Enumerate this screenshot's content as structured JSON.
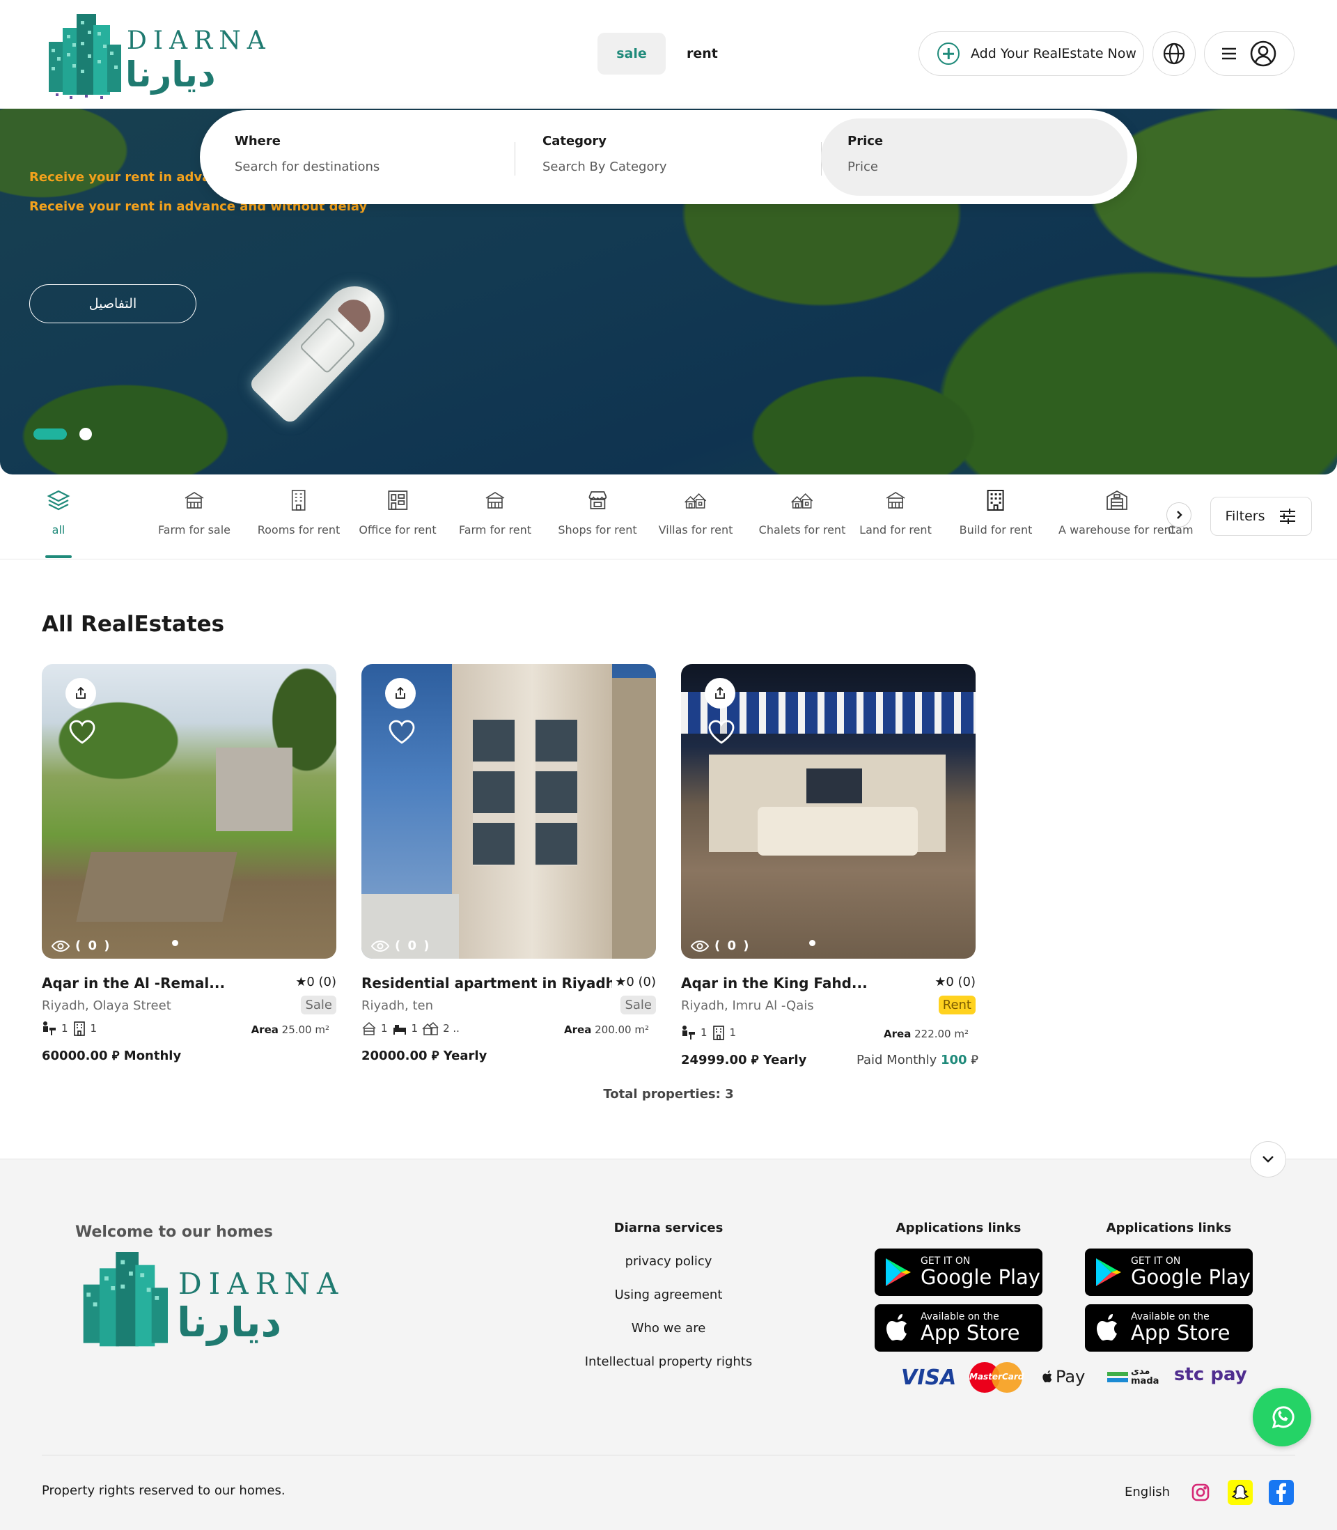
{
  "header": {
    "brand_en": "DIARNA",
    "brand_ar": "ديارنا",
    "mode_tabs": [
      {
        "label": "sale",
        "active": true
      },
      {
        "label": "rent",
        "active": false
      }
    ],
    "add_button": "Add Your RealEstate Now",
    "accent_color": "#1f8a7a"
  },
  "hero": {
    "line1": "Receive your rent in advance and without delay",
    "line2": "Receive your rent in advance and without delay",
    "details_button": "التفاصيل",
    "slides": 2,
    "active_slide": 1
  },
  "search": {
    "where_label": "Where",
    "where_placeholder": "Search for destinations",
    "category_label": "Category",
    "category_placeholder": "Search By Category",
    "price_label": "Price",
    "price_placeholder": "Price"
  },
  "categories": [
    {
      "label": "all",
      "icon": "layers-icon",
      "active": true
    },
    {
      "label": "Farm for sale",
      "icon": "farm-icon"
    },
    {
      "label": "Rooms for rent",
      "icon": "building-icon"
    },
    {
      "label": "Office for rent",
      "icon": "office-icon"
    },
    {
      "label": "Farm for rent",
      "icon": "farm-icon"
    },
    {
      "label": "Shops for rent",
      "icon": "shop-icon"
    },
    {
      "label": "Villas for rent",
      "icon": "villa-icon"
    },
    {
      "label": "Chalets for rent",
      "icon": "chalet-icon"
    },
    {
      "label": "Land for rent",
      "icon": "land-icon"
    },
    {
      "label": "Build for rent",
      "icon": "tower-icon"
    },
    {
      "label": "A warehouse for rent",
      "icon": "warehouse-icon"
    },
    {
      "label": "Camps",
      "icon": "camp-icon"
    }
  ],
  "filters_label": "Filters",
  "listings": {
    "title": "All RealEstates",
    "total": "Total properties: 3",
    "items": [
      {
        "title": "Aqar in the Al -Remal...",
        "rating": "0 (0)",
        "location": "Riyadh, Olaya Street",
        "badge": "Sale",
        "views": "( 0 )",
        "f1": "1",
        "f2": "1",
        "area_label": "Area",
        "area": "25.00 m²",
        "price": "60000.00",
        "period": "Monthly",
        "currency_symbol": "⃁"
      },
      {
        "title": "Residential apartment in Riyadh",
        "rating": "0 (0)",
        "location": "Riyadh, ten",
        "badge": "Sale",
        "views": "( 0 )",
        "f1": "1",
        "f2": "1",
        "f3": "2 ..",
        "area_label": "Area",
        "area": "200.00 m²",
        "price": "20000.00",
        "period": "Yearly",
        "currency_symbol": "⃁"
      },
      {
        "title": "Aqar in the King Fahd...",
        "rating": "0 (0)",
        "location": "Riyadh, Imru Al -Qais",
        "badge": "Rent",
        "views": "( 0 )",
        "f1": "1",
        "f2": "1",
        "area_label": "Area",
        "area": "222.00 m²",
        "price": "24999.00",
        "period": "Yearly",
        "paid_label": "Paid Monthly",
        "paid_value": "100",
        "currency_symbol": "⃁"
      }
    ]
  },
  "footer": {
    "welcome": "Welcome to our homes",
    "services_title": "Diarna services",
    "links": [
      "privacy policy",
      "Using agreement",
      "Who we are",
      "Intellectual property rights"
    ],
    "apps_title_1": "Applications links",
    "apps_title_2": "Applications links",
    "google_small": "GET IT ON",
    "google_big": "Google Play",
    "apple_small": "Available on the",
    "apple_big": "App Store",
    "payments": [
      "VISA",
      "MasterCard",
      "Pay",
      "mada",
      "stc pay"
    ],
    "mada_ar": "مدى",
    "rights": "Property rights reserved to our homes.",
    "language": "English"
  }
}
